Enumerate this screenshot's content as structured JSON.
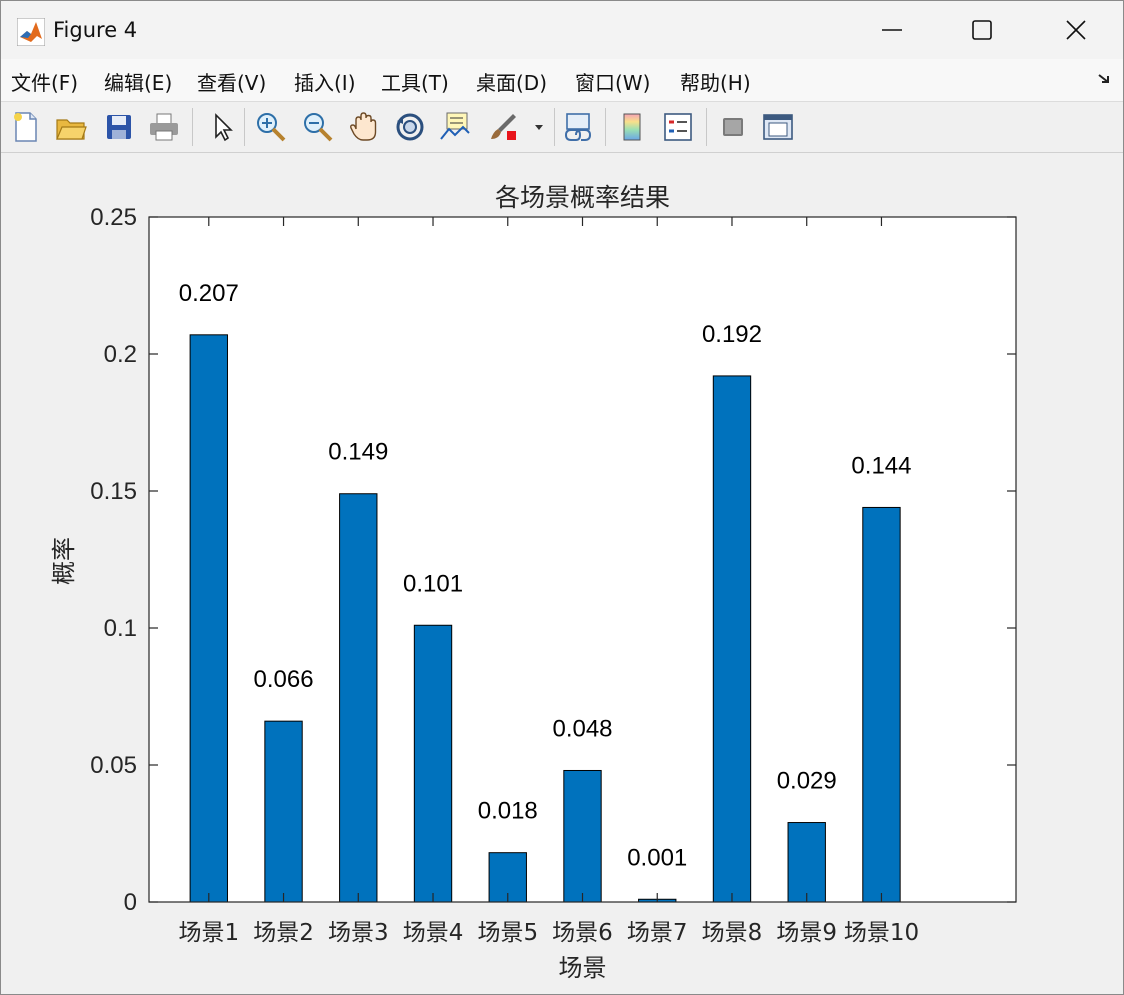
{
  "window": {
    "title": "Figure 4",
    "controls": {
      "minimize": "minimize",
      "maximize": "maximize",
      "close": "close"
    }
  },
  "menu": {
    "items": [
      {
        "label": "文件(F)"
      },
      {
        "label": "编辑(E)"
      },
      {
        "label": "查看(V)"
      },
      {
        "label": "插入(I)"
      },
      {
        "label": "工具(T)"
      },
      {
        "label": "桌面(D)"
      },
      {
        "label": "窗口(W)"
      },
      {
        "label": "帮助(H)"
      }
    ]
  },
  "toolbar": {
    "icons": [
      "new-figure-icon",
      "open-file-icon",
      "save-icon",
      "print-icon",
      "select-arrow-icon",
      "zoom-in-icon",
      "zoom-out-icon",
      "pan-hand-icon",
      "rotate-3d-icon",
      "data-cursor-icon",
      "brush-icon",
      "brush-dropdown-icon",
      "link-plot-icon",
      "colorbar-icon",
      "legend-icon",
      "hide-plot-tools-icon",
      "show-plot-tools-icon"
    ]
  },
  "colors": {
    "bar": "#0072BD",
    "axes_bg": "#ffffff",
    "figure_bg": "#f0f0f0"
  },
  "chart_data": {
    "type": "bar",
    "title": "各场景概率结果",
    "xlabel": "场景",
    "ylabel": "概率",
    "categories": [
      "场景1",
      "场景2",
      "场景3",
      "场景4",
      "场景5",
      "场景6",
      "场景7",
      "场景8",
      "场景9",
      "场景10"
    ],
    "values": [
      0.207,
      0.066,
      0.149,
      0.101,
      0.018,
      0.048,
      0.001,
      0.192,
      0.029,
      0.144
    ],
    "data_labels": [
      "0.207",
      "0.066",
      "0.149",
      "0.101",
      "0.018",
      "0.048",
      "0.001",
      "0.192",
      "0.029",
      "0.144"
    ],
    "ylim": [
      0,
      0.25
    ],
    "yticks": [
      0,
      0.05,
      0.1,
      0.15,
      0.2,
      0.25
    ],
    "ytick_labels": [
      "0",
      "0.05",
      "0.1",
      "0.15",
      "0.2",
      "0.25"
    ],
    "grid": false,
    "legend": "none"
  }
}
